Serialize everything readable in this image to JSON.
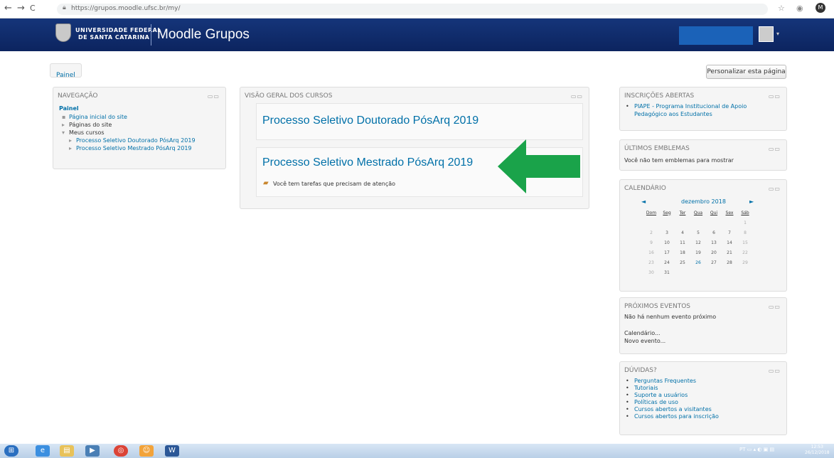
{
  "browser": {
    "url": "https://grupos.moodle.ufsc.br/my/",
    "avatar_letter": "M"
  },
  "header": {
    "university_line1": "UNIVERSIDADE FEDERAL",
    "university_line2": "DE SANTA CATARINA",
    "site_name": "Moodle Grupos"
  },
  "breadcrumb": {
    "item": "Painel"
  },
  "customize_button": "Personalizar esta página",
  "navigation": {
    "title": "NAVEGAÇÃO",
    "home": "Painel",
    "items": [
      "Página inicial do site",
      "Páginas do site",
      "Meus cursos",
      "Processo Seletivo Doutorado PósArq 2019",
      "Processo Seletivo Mestrado PósArq 2019"
    ]
  },
  "courses_overview": {
    "title": "VISÃO GERAL DOS CURSOS",
    "courses": [
      {
        "name": "Processo Seletivo Doutorado PósArq 2019"
      },
      {
        "name": "Processo Seletivo Mestrado PósArq 2019",
        "note": "Você tem tarefas que precisam de atenção"
      }
    ]
  },
  "open_enrolments": {
    "title": "INSCRIÇÕES ABERTAS",
    "item_line1": "PIAPE - Programa Institucional de Apoio",
    "item_line2": "Pedagógico aos Estudantes"
  },
  "badges": {
    "title": "ÚLTIMOS EMBLEMAS",
    "text": "Você não tem emblemas para mostrar"
  },
  "calendar": {
    "title": "CALENDÁRIO",
    "month": "dezembro 2018",
    "prev": "◄",
    "next": "►",
    "weekdays": [
      "Dom",
      "Seg",
      "Ter",
      "Qua",
      "Qui",
      "Sex",
      "Sáb"
    ],
    "weeks": [
      [
        "",
        "",
        "",
        "",
        "",
        "",
        "1"
      ],
      [
        "2",
        "3",
        "4",
        "5",
        "6",
        "7",
        "8"
      ],
      [
        "9",
        "10",
        "11",
        "12",
        "13",
        "14",
        "15"
      ],
      [
        "16",
        "17",
        "18",
        "19",
        "20",
        "21",
        "22"
      ],
      [
        "23",
        "24",
        "25",
        "26",
        "27",
        "28",
        "29"
      ],
      [
        "30",
        "31",
        "",
        "",
        "",
        "",
        ""
      ]
    ]
  },
  "events": {
    "title": "PRÓXIMOS EVENTOS",
    "text": "Não há nenhum evento próximo",
    "link1": "Calendário...",
    "link2": "Novo evento..."
  },
  "help": {
    "title": "DÚVIDAS?",
    "items": [
      "Perguntas Frequentes",
      "Tutoriais",
      "Suporte a usuários",
      "Políticas de uso",
      "Cursos abertos a visitantes",
      "Cursos abertos para inscrição"
    ]
  },
  "taskbar": {
    "lang": "PT",
    "time": "12:53",
    "date": "26/12/2018"
  },
  "colors": {
    "header": "#0f2b6a",
    "link": "#0070a8",
    "arrow": "#1aa34a"
  }
}
